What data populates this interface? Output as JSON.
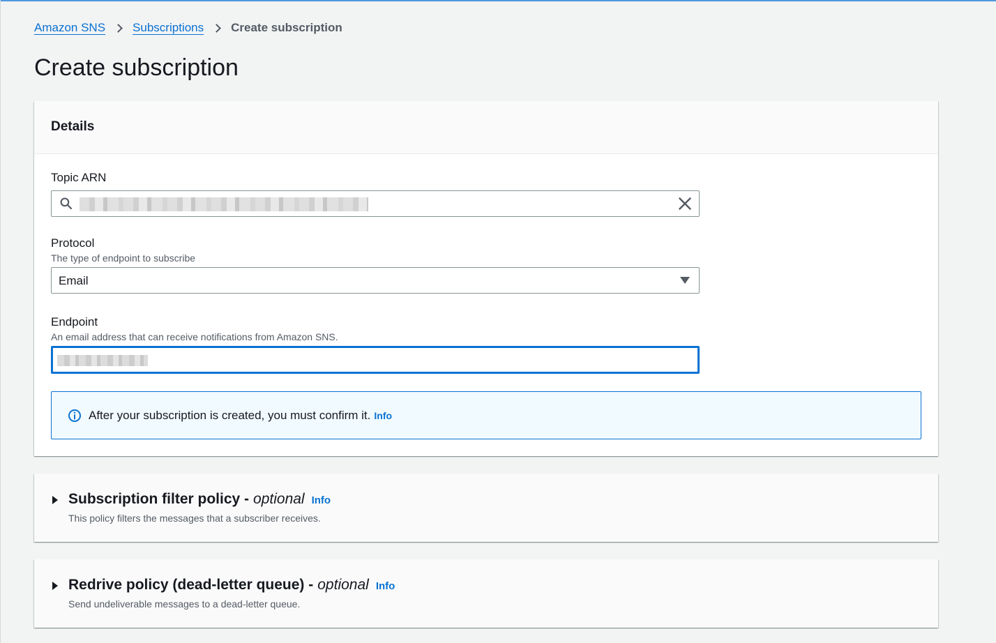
{
  "breadcrumb": {
    "items": [
      "Amazon SNS",
      "Subscriptions"
    ],
    "current": "Create subscription"
  },
  "page": {
    "title": "Create subscription"
  },
  "details": {
    "header": "Details",
    "topic_arn": {
      "label": "Topic ARN"
    },
    "protocol": {
      "label": "Protocol",
      "description": "The type of endpoint to subscribe",
      "selected": "Email"
    },
    "endpoint": {
      "label": "Endpoint",
      "description": "An email address that can receive notifications from Amazon SNS."
    },
    "alert": {
      "text": "After your subscription is created, you must confirm it.",
      "link": "Info"
    }
  },
  "filter_policy": {
    "title": "Subscription filter policy -",
    "optional": "optional",
    "info": "Info",
    "description": "This policy filters the messages that a subscriber receives."
  },
  "redrive_policy": {
    "title": "Redrive policy (dead-letter queue) -",
    "optional": "optional",
    "info": "Info",
    "description": "Send undeliverable messages to a dead-letter queue."
  },
  "colors": {
    "link": "#0972d3",
    "background": "#f2f3f3",
    "alert_bg": "#f1faff"
  }
}
